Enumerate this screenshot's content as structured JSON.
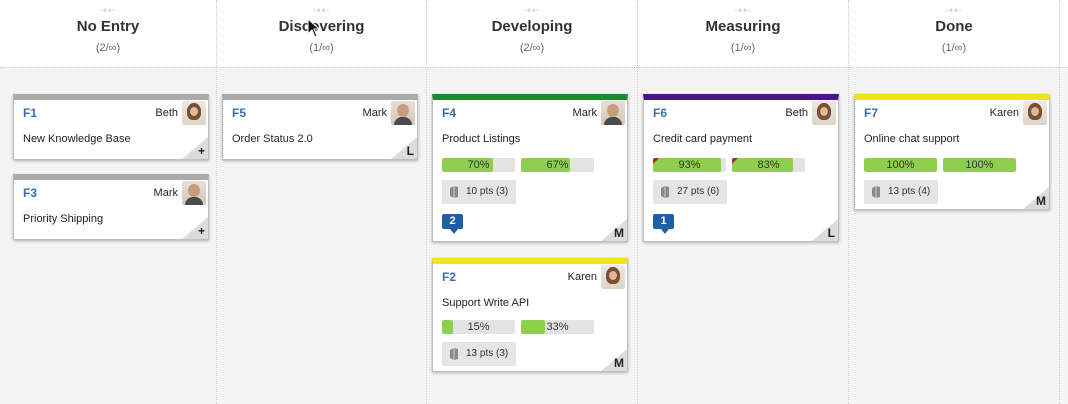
{
  "columns": [
    {
      "title": "No Entry",
      "count": "(2/∞)"
    },
    {
      "title": "Discovering",
      "count": "(1/∞)"
    },
    {
      "title": "Developing",
      "count": "(2/∞)"
    },
    {
      "title": "Measuring",
      "count": "(1/∞)"
    },
    {
      "title": "Done",
      "count": "(1/∞)"
    }
  ],
  "cards": {
    "f1": {
      "id": "F1",
      "owner": "Beth",
      "title": "New Knowledge Base",
      "size": "+",
      "color": "#aaaaaa",
      "avatar": "female"
    },
    "f3": {
      "id": "F3",
      "owner": "Mark",
      "title": "Priority Shipping",
      "size": "+",
      "color": "#aaaaaa",
      "avatar": "male"
    },
    "f5": {
      "id": "F5",
      "owner": "Mark",
      "title": "Order Status 2.0",
      "size": "L",
      "color": "#aaaaaa",
      "avatar": "male"
    },
    "f4": {
      "id": "F4",
      "owner": "Mark",
      "title": "Product Listings",
      "size": "M",
      "color": "#1e8a2e",
      "avatar": "male",
      "progress": [
        {
          "label": "70%",
          "value": 0.7
        },
        {
          "label": "67%",
          "value": 0.67
        }
      ],
      "points": "10 pts (3)",
      "comments": "2"
    },
    "f2": {
      "id": "F2",
      "owner": "Karen",
      "title": "Support Write API",
      "size": "M",
      "color": "#f2e31a",
      "avatar": "female",
      "progress": [
        {
          "label": "15%",
          "value": 0.15
        },
        {
          "label": "33%",
          "value": 0.33
        }
      ],
      "points": "13 pts (3)"
    },
    "f6": {
      "id": "F6",
      "owner": "Beth",
      "title": "Credit card payment",
      "size": "L",
      "color": "#4b1589",
      "avatar": "female",
      "progress": [
        {
          "label": "93%",
          "value": 0.93
        },
        {
          "label": "83%",
          "value": 0.83
        }
      ],
      "points": "27 pts (6)",
      "comments": "1"
    },
    "f7": {
      "id": "F7",
      "owner": "Karen",
      "title": "Online chat support",
      "size": "M",
      "color": "#f2e31a",
      "avatar": "female",
      "progress": [
        {
          "label": "100%",
          "value": 1.0
        },
        {
          "label": "100%",
          "value": 1.0
        }
      ],
      "points": "13 pts (4)"
    }
  },
  "icons": {
    "points": "book-icon",
    "comments": "comment-icon",
    "resize": "drag-arrows-icon"
  }
}
